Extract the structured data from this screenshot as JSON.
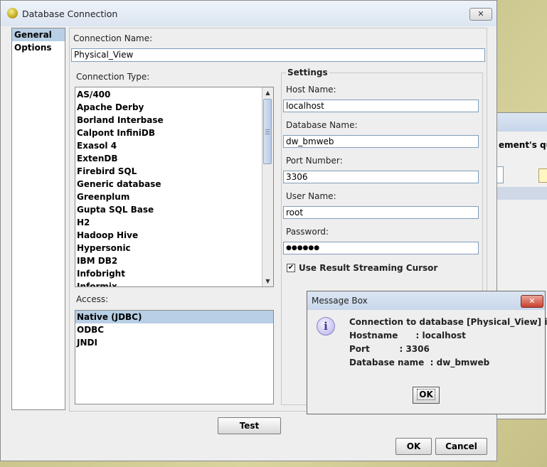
{
  "background_window": {
    "text": "ement's que"
  },
  "dialog": {
    "title": "Database Connection",
    "close_glyph": "✕"
  },
  "nav": {
    "items": [
      {
        "label": "General",
        "selected": true
      },
      {
        "label": "Options",
        "selected": false
      }
    ]
  },
  "general": {
    "connection_name_label": "Connection Name:",
    "connection_name_value": "Physical_View",
    "connection_type_label": "Connection Type:",
    "connection_types": [
      "AS/400",
      "Apache Derby",
      "Borland Interbase",
      "Calpont InfiniDB",
      "Exasol 4",
      "ExtenDB",
      "Firebird SQL",
      "Generic database",
      "Greenplum",
      "Gupta SQL Base",
      "H2",
      "Hadoop Hive",
      "Hypersonic",
      "IBM DB2",
      "Infobright",
      "Informix"
    ],
    "access_label": "Access:",
    "access_options": [
      {
        "label": "Native (JDBC)",
        "selected": true
      },
      {
        "label": "ODBC",
        "selected": false
      },
      {
        "label": "JNDI",
        "selected": false
      }
    ],
    "settings": {
      "title": "Settings",
      "host_name_label": "Host Name:",
      "host_name_value": "localhost",
      "database_name_label": "Database Name:",
      "database_name_value": "dw_bmweb",
      "port_number_label": "Port Number:",
      "port_number_value": "3306",
      "user_name_label": "User Name:",
      "user_name_value": "root",
      "password_label": "Password:",
      "password_value": "●●●●●●",
      "streaming_cursor_label": "Use Result Streaming Cursor",
      "streaming_cursor_checked": true
    }
  },
  "buttons": {
    "test": "Test",
    "ok": "OK",
    "cancel": "Cancel"
  },
  "message_box": {
    "title": "Message Box",
    "close_glyph": "✕",
    "info_glyph": "i",
    "lines": [
      "Connection to database [Physical_View] is OK.",
      "Hostname      : localhost",
      "Port          : 3306",
      "Database name  : dw_bmweb"
    ],
    "ok": "OK"
  },
  "colors": {
    "selection": "#b8cfe5",
    "title_bar": "#dbe5f1",
    "close_red": "#c94030"
  }
}
